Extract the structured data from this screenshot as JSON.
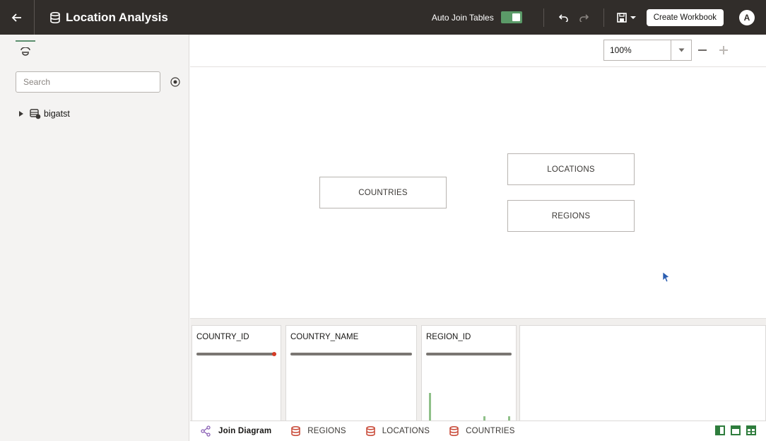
{
  "header": {
    "title": "Location Analysis",
    "auto_join_label": "Auto Join Tables",
    "auto_join_on": true,
    "create_workbook_label": "Create Workbook",
    "avatar_initial": "A",
    "bg_color": "#312d2a"
  },
  "left_panel": {
    "search_placeholder": "Search",
    "tree": [
      {
        "label": "bigatst",
        "expanded": false
      }
    ]
  },
  "zoom": {
    "value": "100%"
  },
  "diagram": {
    "tables": [
      "COUNTRIES",
      "LOCATIONS",
      "REGIONS"
    ]
  },
  "preview": {
    "columns": [
      {
        "name": "COUNTRY_ID"
      },
      {
        "name": "COUNTRY_NAME"
      },
      {
        "name": "REGION_ID"
      }
    ]
  },
  "bottom_tabs": [
    {
      "label": "Join Diagram",
      "icon": "join-diagram-icon",
      "active": true
    },
    {
      "label": "REGIONS",
      "icon": "database-table-icon",
      "active": false
    },
    {
      "label": "LOCATIONS",
      "icon": "database-table-icon",
      "active": false
    },
    {
      "label": "COUNTRIES",
      "icon": "database-table-icon",
      "active": false
    }
  ],
  "colors": {
    "accent_green": "#5b9a68",
    "table_icon_red": "#c74634",
    "histogram_green": "#8fc089"
  }
}
